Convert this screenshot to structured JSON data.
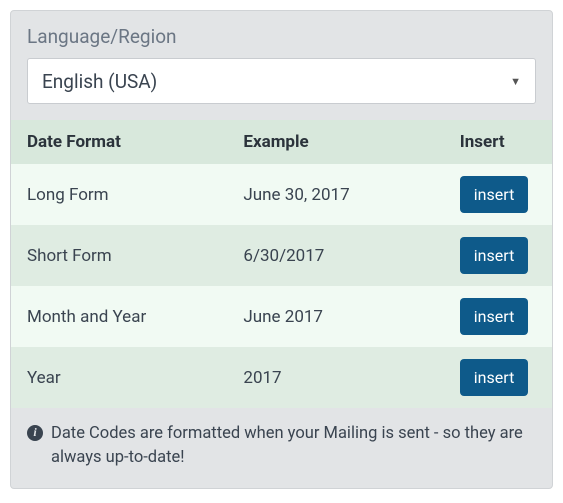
{
  "panel": {
    "title": "Language/Region",
    "language_select": {
      "selected": "English (USA)"
    }
  },
  "table": {
    "headers": {
      "format": "Date Format",
      "example": "Example",
      "insert": "Insert"
    },
    "rows": [
      {
        "format": "Long Form",
        "example": "June 30, 2017",
        "button": "insert"
      },
      {
        "format": "Short Form",
        "example": "6/30/2017",
        "button": "insert"
      },
      {
        "format": "Month and Year",
        "example": "June 2017",
        "button": "insert"
      },
      {
        "format": "Year",
        "example": "2017",
        "button": "insert"
      }
    ]
  },
  "footer": {
    "note": "Date Codes are formatted when your Mailing is sent - so they are always up-to-date!"
  }
}
